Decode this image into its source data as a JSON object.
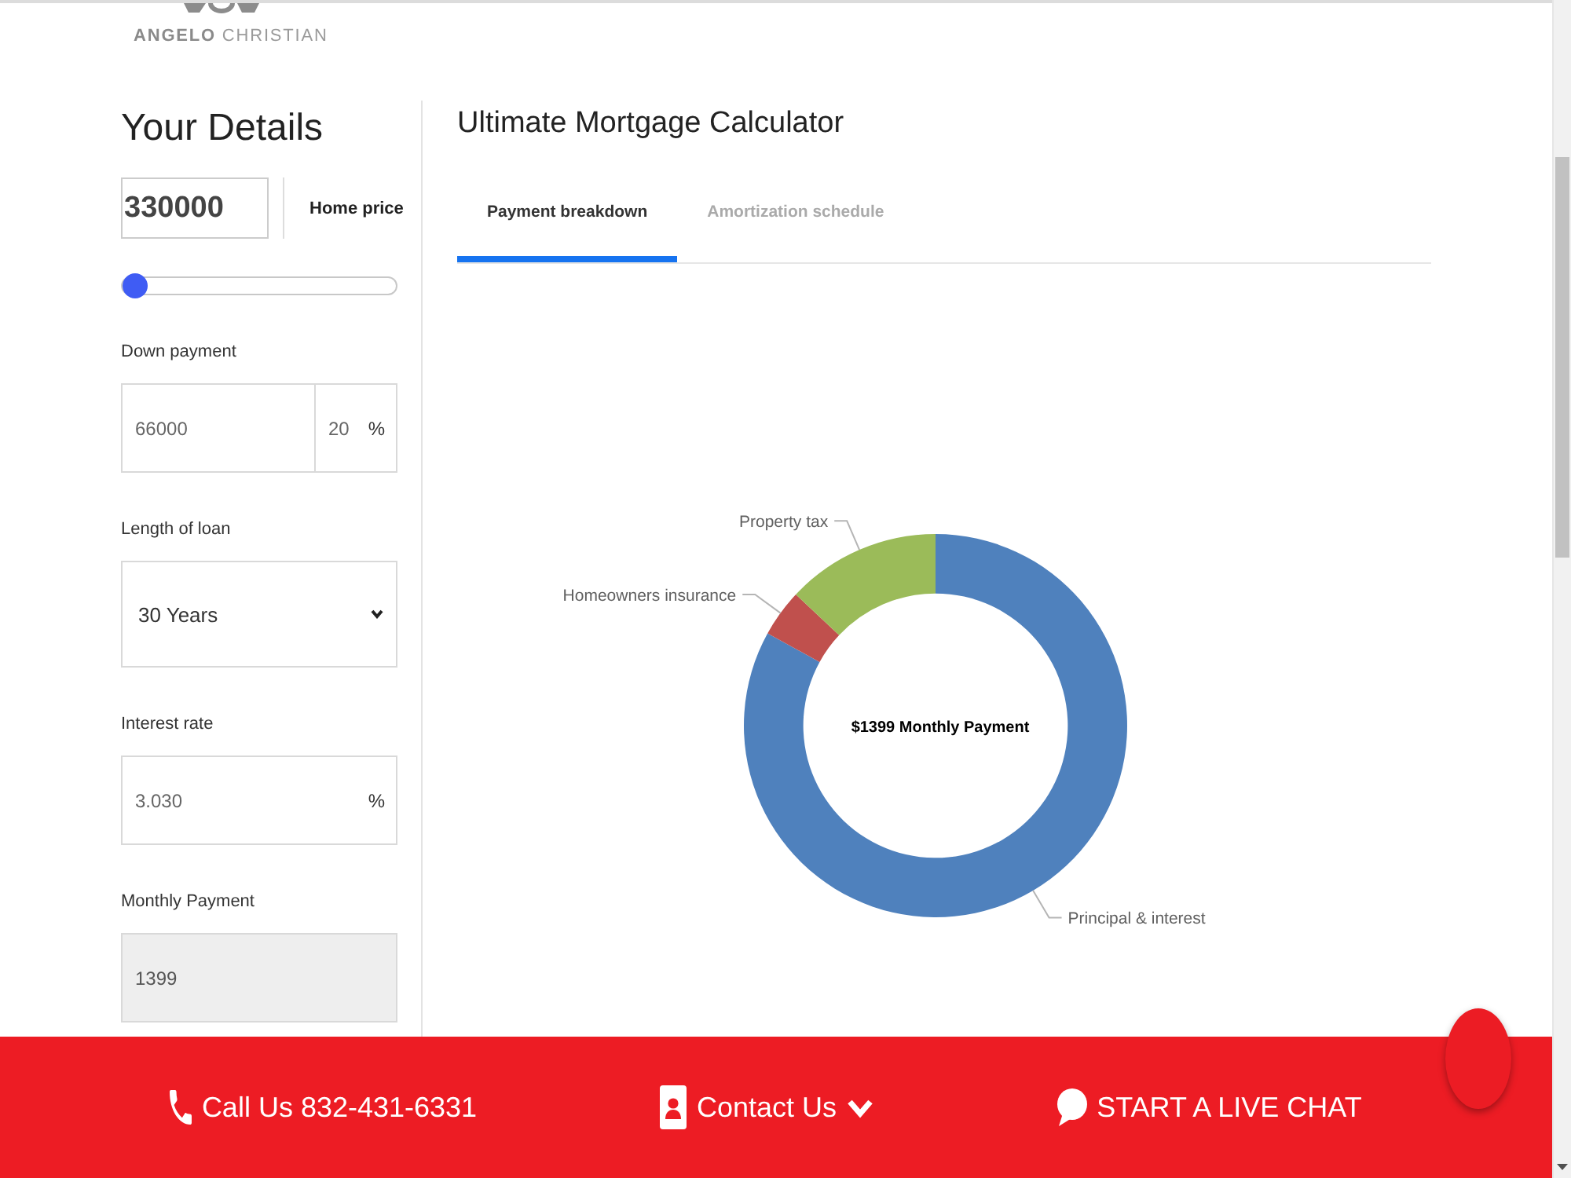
{
  "logo": {
    "text": "**ANGELO** CHRISTIAN"
  },
  "details": {
    "title": "Your Details",
    "home_price": {
      "value": "330000",
      "label": "Home price",
      "slider": {
        "level": 0
      }
    },
    "down_payment": {
      "label": "Down payment",
      "amount": "66000",
      "percent": "20",
      "unit": "%"
    },
    "loan_length": {
      "label": "Length of loan",
      "value": "30 Years"
    },
    "interest_rate": {
      "label": "Interest rate",
      "value": "3.030",
      "unit": "%"
    },
    "monthly_payment": {
      "label": "Monthly Payment",
      "value": "1399",
      "disabled": true
    }
  },
  "calculator": {
    "title": "Ultimate Mortgage Calculator",
    "tabs": [
      {
        "label": "Payment breakdown",
        "selected": true
      },
      {
        "label": "Amortization schedule",
        "selected": false
      }
    ],
    "chart_data": [
      {
        "type": "donut",
        "title": "$1399 Monthly Payment",
        "categories": [
          "Principal & interest",
          "Homeowners insurance",
          "Property tax"
        ],
        "values": [
          83,
          4,
          13
        ],
        "colors": [
          "#4f81bd",
          "#c0504d",
          "#9bbb59"
        ]
      }
    ]
  },
  "contact_bar": {
    "call": "Call Us 832-431-6331",
    "contact": "Contact Us",
    "chat": "START A LIVE CHAT"
  }
}
